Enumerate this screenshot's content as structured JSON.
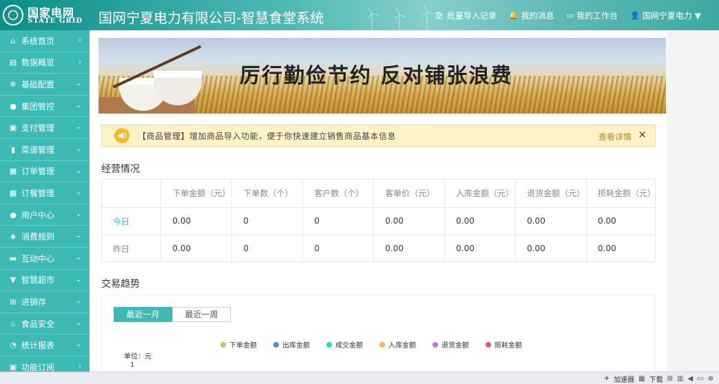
{
  "header": {
    "logo_cn": "国家电网",
    "logo_en": "STATE GRID",
    "title": "国网宁夏电力有限公司-智慧食堂系统",
    "links": [
      {
        "icon": "bag-icon",
        "glyph": "🛍",
        "label": "批量导入记录"
      },
      {
        "icon": "bell-icon",
        "glyph": "🔔",
        "label": "我的消息"
      },
      {
        "icon": "monitor-icon",
        "glyph": "▭",
        "label": "我的工作台"
      },
      {
        "icon": "user-icon",
        "glyph": "👤",
        "label": "国网宁夏电力"
      }
    ],
    "dropdown_glyph": "▼"
  },
  "sidebar": {
    "items": [
      {
        "icon": "home-icon",
        "glyph": "⌂",
        "label": "系统首页",
        "arrow": "›"
      },
      {
        "icon": "chart-icon",
        "glyph": "▤",
        "label": "数据概览",
        "arrow": "›"
      },
      {
        "icon": "gear-icon",
        "glyph": "✲",
        "label": "基础配置",
        "arrow": "⌄"
      },
      {
        "icon": "user-icon",
        "glyph": "●",
        "label": "集团管控",
        "arrow": "⌄"
      },
      {
        "icon": "payment-icon",
        "glyph": "▣",
        "label": "支付管理",
        "arrow": "⌄"
      },
      {
        "icon": "menu-book-icon",
        "glyph": "▮",
        "label": "菜谱管理",
        "arrow": "⌄"
      },
      {
        "icon": "order-icon",
        "glyph": "▦",
        "label": "订单管理",
        "arrow": "⌄"
      },
      {
        "icon": "meal-order-icon",
        "glyph": "▦",
        "label": "订餐管理",
        "arrow": "⌄"
      },
      {
        "icon": "user-center-icon",
        "glyph": "●",
        "label": "用户中心",
        "arrow": "⌄"
      },
      {
        "icon": "tag-icon",
        "glyph": "◈",
        "label": "消费规则",
        "arrow": "⌄"
      },
      {
        "icon": "chat-icon",
        "glyph": "▬",
        "label": "互动中心",
        "arrow": "⌄"
      },
      {
        "icon": "basket-icon",
        "glyph": "▼",
        "label": "智慧超市",
        "arrow": "⌄"
      },
      {
        "icon": "cart-icon",
        "glyph": "⊞",
        "label": "进销存",
        "arrow": "⌄"
      },
      {
        "icon": "food-safety-icon",
        "glyph": "♨",
        "label": "食品安全",
        "arrow": "⌄"
      },
      {
        "icon": "pie-chart-icon",
        "glyph": "◔",
        "label": "统计报表",
        "arrow": "⌄"
      },
      {
        "icon": "feature-icon",
        "glyph": "▣",
        "label": "功能订阅",
        "arrow": "›"
      }
    ]
  },
  "banner": {
    "text": "厉行勤俭节约  反对铺张浪费"
  },
  "notice": {
    "text": "【商品管理】增加商品导入功能，便于你快速建立销售商品基本信息",
    "link": "查看详情",
    "close": "✕",
    "icon_glyph": "◀)"
  },
  "operations": {
    "title": "经营情况",
    "columns": [
      "下单金额（元）",
      "下单数（个）",
      "客户数（个）",
      "客单价（元）",
      "入库金额（元）",
      "退货金额（元）",
      "损耗金额（元）"
    ],
    "rows": [
      {
        "label": "今日",
        "values": [
          "0.00",
          "0",
          "0",
          "0.00",
          "0.00",
          "0.00",
          "0.00"
        ]
      },
      {
        "label": "昨日",
        "values": [
          "0.00",
          "0",
          "0",
          "0.00",
          "0.00",
          "0.00",
          "0.00"
        ]
      }
    ]
  },
  "trend": {
    "title": "交易趋势",
    "tabs": [
      "最近一月",
      "最近一周"
    ],
    "active_tab": 0,
    "legend": [
      {
        "name": "下单金额",
        "color": "#9ad66b"
      },
      {
        "name": "出库金额",
        "color": "#4a90d9"
      },
      {
        "name": "成交金额",
        "color": "#2ed1c4"
      },
      {
        "name": "入库金额",
        "color": "#f0b93a"
      },
      {
        "name": "退货金额",
        "color": "#b477e6"
      },
      {
        "name": "损耗金额",
        "color": "#e8575a"
      }
    ],
    "unit": "单位：元",
    "y_first_tick": "1"
  },
  "statusbar": {
    "items": [
      "加速器",
      "下载"
    ]
  },
  "colors": {
    "accent": "#3dbab3",
    "sidebar_bg": "#3dbab3",
    "notice_bg": "#fdf3c7"
  }
}
